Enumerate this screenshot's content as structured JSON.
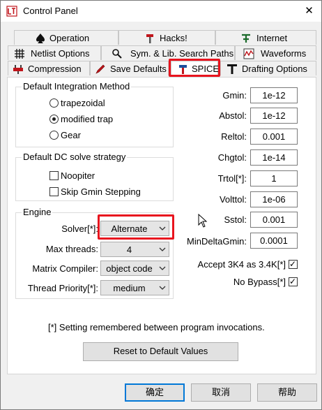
{
  "window": {
    "title": "Control Panel",
    "close_glyph": "✕",
    "icon": "ltspice-app-icon"
  },
  "tabs": {
    "row1": [
      {
        "label": "Operation",
        "icon": "spade-icon"
      },
      {
        "label": "Hacks!",
        "icon": "hammer-icon"
      },
      {
        "label": "Internet",
        "icon": "network-icon"
      }
    ],
    "row2": [
      {
        "label": "Netlist Options",
        "icon": "grid-icon"
      },
      {
        "label": "Sym. & Lib. Search Paths",
        "icon": "magnifier-icon"
      },
      {
        "label": "Waveforms",
        "icon": "waveform-icon"
      }
    ],
    "row3": [
      {
        "label": "Compression",
        "icon": "press-icon"
      },
      {
        "label": "Save Defaults",
        "icon": "pencil-icon"
      },
      {
        "label": "SPICE",
        "icon": "hammer-wrench-icon",
        "active": true
      },
      {
        "label": "Drafting Options",
        "icon": "t-square-icon"
      }
    ]
  },
  "integration": {
    "title": "Default Integration Method",
    "options": [
      "trapezoidal",
      "modified trap",
      "Gear"
    ],
    "selected": "modified trap"
  },
  "dc_solve": {
    "title": "Default DC solve strategy",
    "options": [
      {
        "label": "Noopiter",
        "checked": false
      },
      {
        "label": "Skip Gmin Stepping",
        "checked": false
      }
    ]
  },
  "engine": {
    "title": "Engine",
    "rows": [
      {
        "label": "Solver[*]:",
        "value": "Alternate"
      },
      {
        "label": "Max threads:",
        "value": "4"
      },
      {
        "label": "Matrix Compiler:",
        "value": "object code"
      },
      {
        "label": "Thread Priority[*]:",
        "value": "medium"
      }
    ]
  },
  "tolerances": [
    {
      "label": "Gmin:",
      "value": "1e-12"
    },
    {
      "label": "Abstol:",
      "value": "1e-12"
    },
    {
      "label": "Reltol:",
      "value": "0.001"
    },
    {
      "label": "Chgtol:",
      "value": "1e-14"
    },
    {
      "label": "Trtol[*]:",
      "value": "1"
    },
    {
      "label": "Volttol:",
      "value": "1e-06"
    },
    {
      "label": "Sstol:",
      "value": "0.001"
    },
    {
      "label": "MinDeltaGmin:",
      "value": "0.0001"
    }
  ],
  "options_right": [
    {
      "label": "Accept 3K4 as 3.4K[*]",
      "checked": true
    },
    {
      "label": "No Bypass[*]",
      "checked": true
    }
  ],
  "note": "[*] Setting remembered between program invocations.",
  "reset_label": "Reset to Default Values",
  "buttons": {
    "ok": "确定",
    "cancel": "取消",
    "help": "帮助"
  },
  "colors": {
    "highlight": "#e8141e",
    "focus": "#0078d7"
  }
}
